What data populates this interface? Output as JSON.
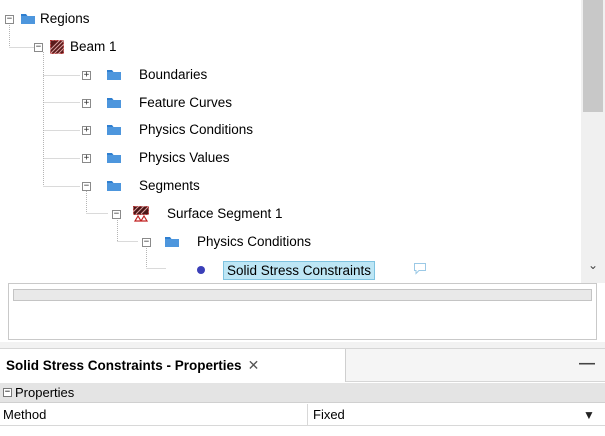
{
  "tree": {
    "items": [
      {
        "label": "Regions",
        "icon": "folder-icon",
        "expander": "minus"
      },
      {
        "label": "Beam 1",
        "icon": "region-icon",
        "expander": "minus"
      },
      {
        "label": "Boundaries",
        "icon": "folder-icon",
        "expander": "plus"
      },
      {
        "label": "Feature Curves",
        "icon": "folder-icon",
        "expander": "plus"
      },
      {
        "label": "Physics Conditions",
        "icon": "folder-icon",
        "expander": "plus"
      },
      {
        "label": "Physics Values",
        "icon": "folder-icon",
        "expander": "plus"
      },
      {
        "label": "Segments",
        "icon": "folder-icon",
        "expander": "minus"
      },
      {
        "label": "Surface Segment 1",
        "icon": "segment-icon",
        "expander": "minus"
      },
      {
        "label": "Physics Conditions",
        "icon": "folder-icon",
        "expander": "minus"
      },
      {
        "label": "Solid Stress Constraints",
        "icon": "dot-icon",
        "expander": "none",
        "selected": true
      }
    ]
  },
  "scrollbar": {
    "down_arrow": "⌄"
  },
  "properties_panel": {
    "tab_title": "Solid Stress Constraints - Properties",
    "close_glyph": "✕",
    "minimize_glyph": "—",
    "section": {
      "toggle": "−",
      "label": "Properties"
    },
    "rows": [
      {
        "name": "Method",
        "value": "Fixed",
        "dropdown_glyph": "▼"
      }
    ]
  },
  "colors": {
    "folder": "#2f7fd0",
    "selection_bg": "#bde6f5",
    "node_dot": "#3b3fb8"
  }
}
